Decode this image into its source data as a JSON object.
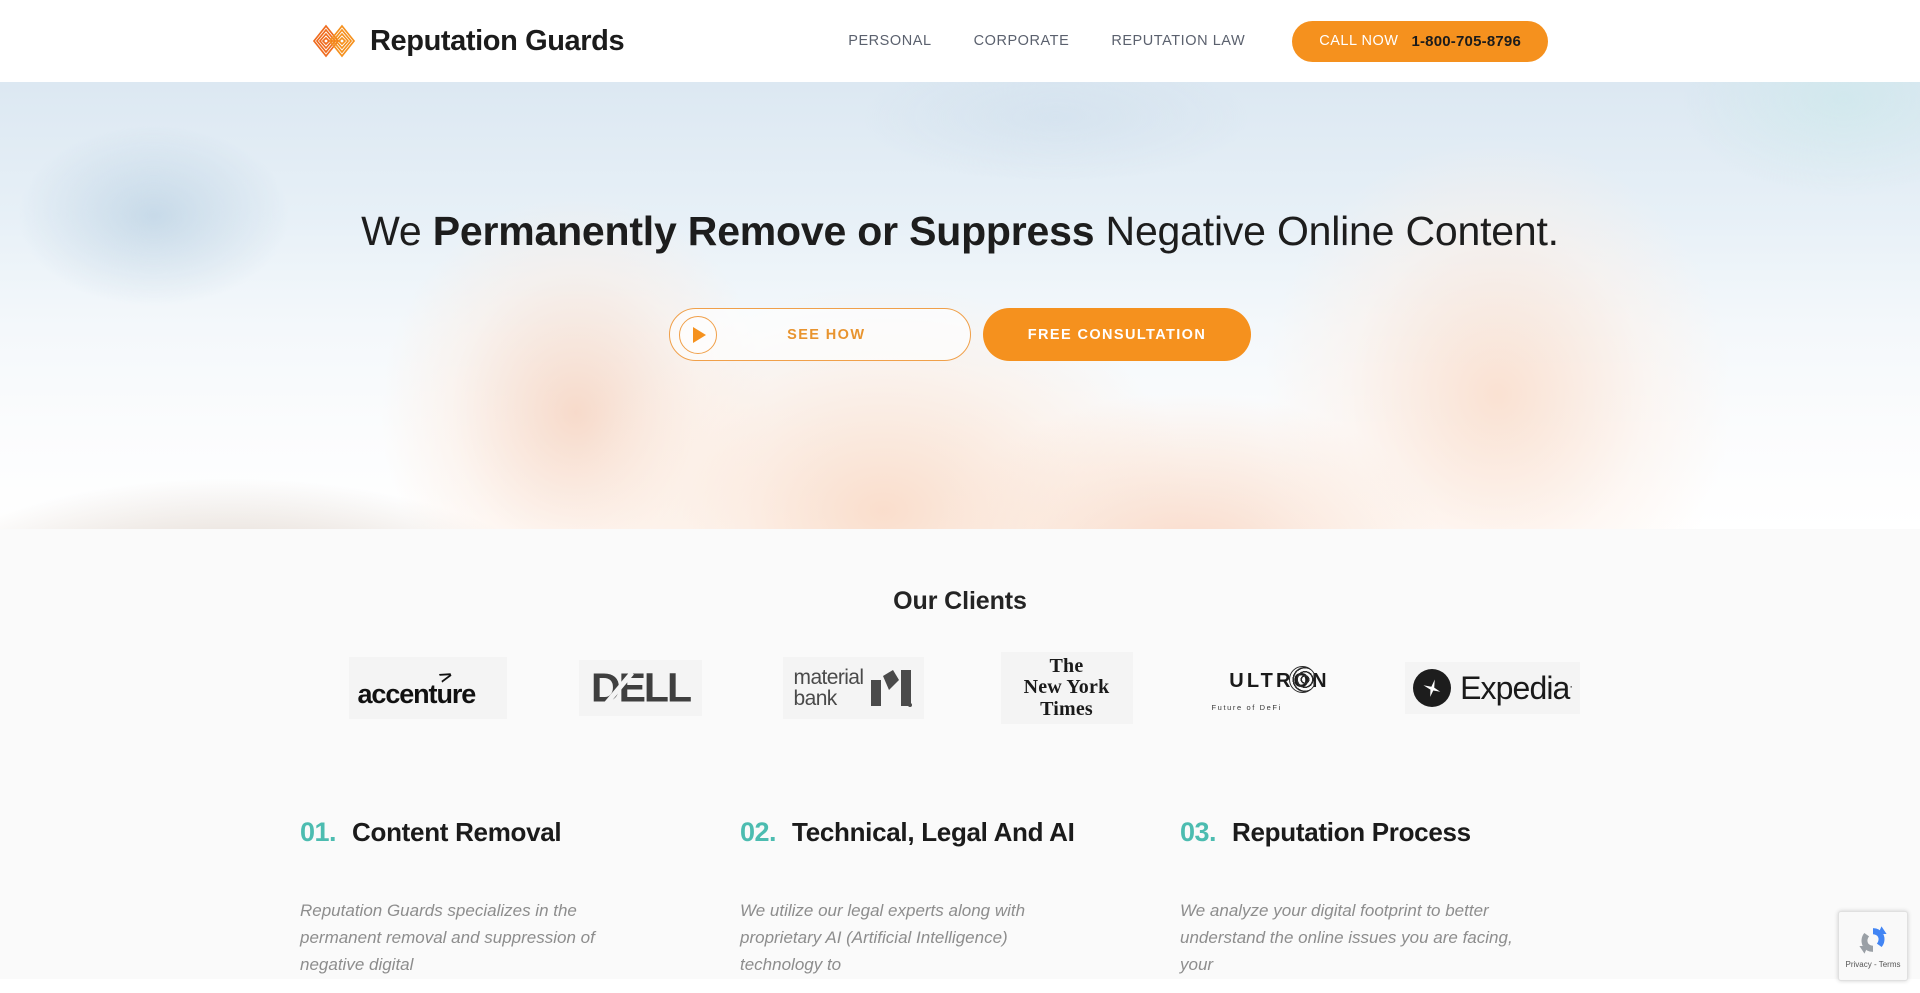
{
  "header": {
    "brand_name": "Reputation Guards",
    "brand_logo_icon": "interlocking-diamonds-logo",
    "nav": [
      {
        "label": "PERSONAL"
      },
      {
        "label": "CORPORATE"
      },
      {
        "label": "REPUTATION LAW"
      }
    ],
    "call_button": {
      "label": "CALL NOW",
      "phone": "1-800-705-8796",
      "bg_color": "#f5911e"
    }
  },
  "hero": {
    "headline_part1": "We ",
    "headline_strong": "Permanently Remove or Suppress",
    "headline_part2": " Negative Online Content.",
    "see_how_label": "SEE HOW",
    "see_how_icon": "play-icon",
    "free_consultation_label": "FREE CONSULTATION",
    "accent_color": "#f5911e"
  },
  "clients": {
    "title": "Our Clients",
    "logos": [
      {
        "name": "accenture",
        "text": "accenture",
        "mark": "greater-than-arrow"
      },
      {
        "name": "dell",
        "text": "DELL"
      },
      {
        "name": "material-bank",
        "line1": "material",
        "line2": "bank",
        "mark": "m-monogram"
      },
      {
        "name": "new-york-times",
        "line1": "The",
        "line2": "New York",
        "line3": "Times"
      },
      {
        "name": "ultron",
        "text": "ULTRON",
        "tagline": "Future of DeFi",
        "mark": "globe-o"
      },
      {
        "name": "expedia",
        "text": "Expedia",
        "mark": "airplane-icon",
        "registered": "."
      }
    ]
  },
  "features": [
    {
      "number": "01.",
      "title": "Content Removal",
      "body": "Reputation Guards specializes in the permanent removal and suppression of negative digital"
    },
    {
      "number": "02.",
      "title": "Technical, Legal And AI",
      "body": "We utilize our legal experts along with proprietary AI (Artificial Intelligence) technology to"
    },
    {
      "number": "03.",
      "title": "Reputation Process",
      "body": "We analyze your digital footprint to better understand the online issues you are facing, your"
    }
  ],
  "recaptcha": {
    "text": "Privacy - Terms",
    "icon": "recaptcha-logo"
  },
  "theme": {
    "orange": "#f5911e",
    "teal": "#4cbcb0",
    "nav_text": "#5b616e",
    "body_text": "#8d8d8d"
  }
}
